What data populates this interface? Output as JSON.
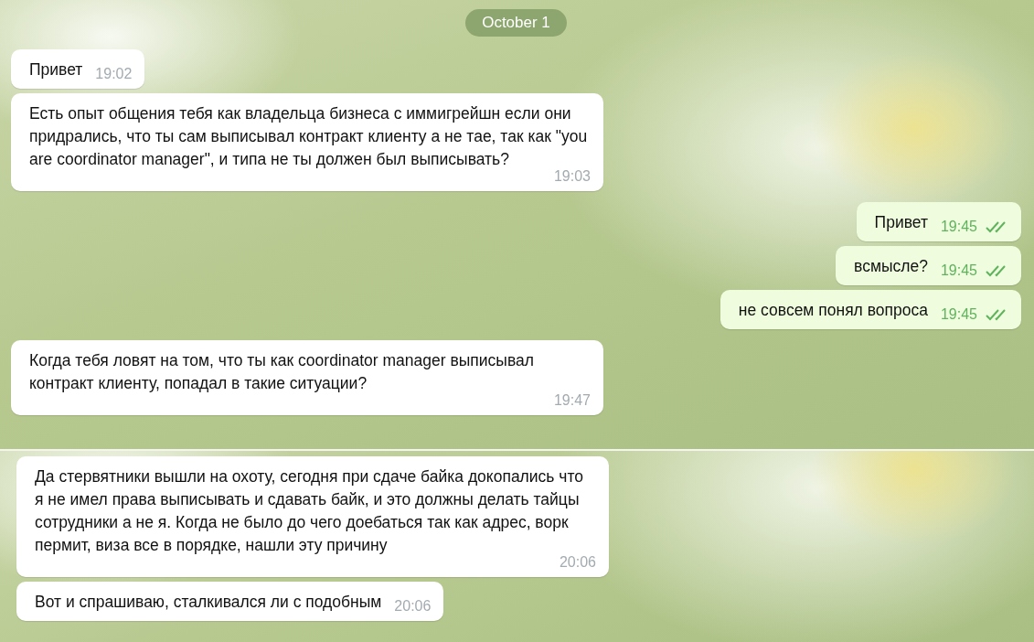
{
  "date_badge": "October 1",
  "sections": [
    {
      "messages": [
        {
          "kind": "incoming",
          "text": "Привет",
          "time": "19:02"
        },
        {
          "kind": "incoming",
          "text": "Есть опыт общения тебя как владельца бизнеса с иммигрейшн если они придрались, что ты сам выписывал контракт клиенту а не тае, так как \"you are coordinator manager\", и типа не ты должен был выписывать?",
          "time": "19:03"
        },
        {
          "kind": "outgoing",
          "text": "Привет",
          "time": "19:45",
          "read": true
        },
        {
          "kind": "outgoing",
          "text": "всмысле?",
          "time": "19:45",
          "read": true
        },
        {
          "kind": "outgoing",
          "text": "не совсем понял вопроса",
          "time": "19:45",
          "read": true
        },
        {
          "kind": "incoming",
          "text": "Когда тебя ловят на том, что ты как coordinator manager выписывал контракт клиенту, попадал в такие ситуации?",
          "time": "19:47"
        }
      ]
    },
    {
      "messages": [
        {
          "kind": "incoming",
          "text": "Да стервятники вышли на охоту, сегодня при сдаче байка докопались что я не имел права выписывать и сдавать байк, и это должны делать тайцы сотрудники а не я. Когда не было до чего доебаться так как адрес, ворк пермит, виза все в порядке, нашли эту причину",
          "time": "20:06"
        },
        {
          "kind": "incoming",
          "text": "Вот и спрашиваю, сталкивался ли с подобным",
          "time": "20:06"
        }
      ]
    }
  ]
}
